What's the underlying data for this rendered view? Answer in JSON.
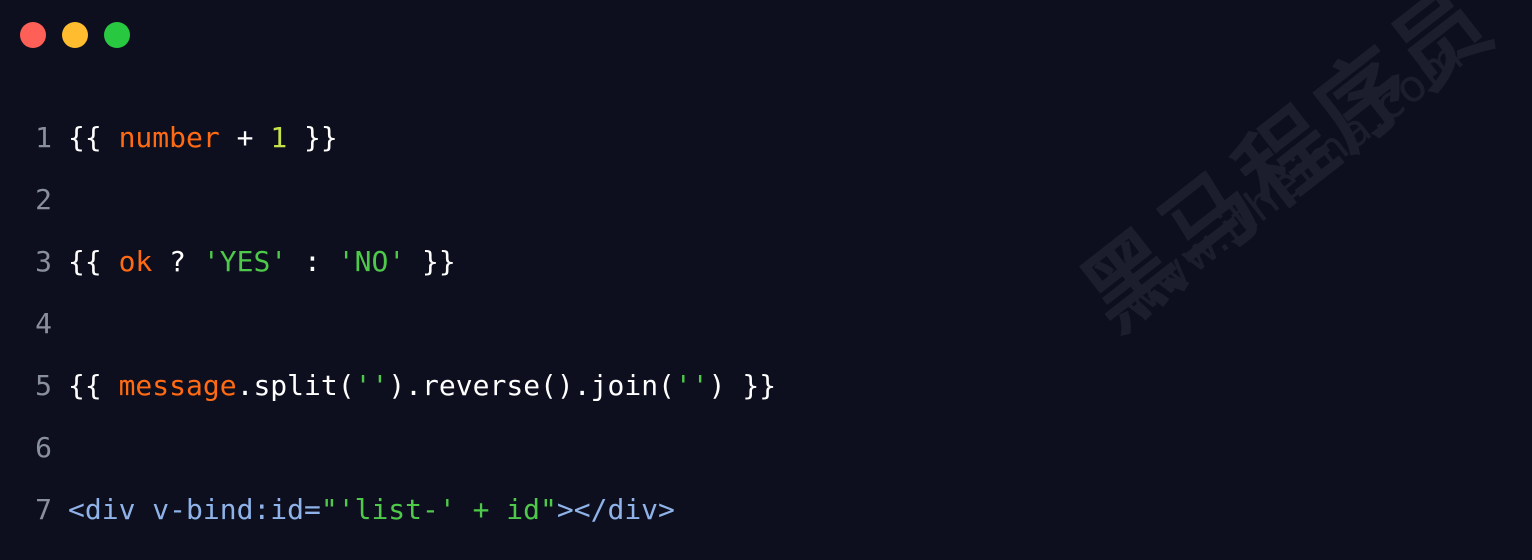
{
  "colors": {
    "background": "#0d0f1f",
    "line_number": "#8a8f9c",
    "white": "#ffffff",
    "variable": "#ff6a13",
    "number": "#c6e24a",
    "string": "#4ec94a",
    "tag": "#8fb3e8"
  },
  "window_controls": [
    "close-dot",
    "minimize-dot",
    "maximize-dot"
  ],
  "code": {
    "lines": [
      {
        "number": "1",
        "tokens": [
          {
            "text": "{{ ",
            "color": "white"
          },
          {
            "text": "number",
            "color": "variable"
          },
          {
            "text": " + ",
            "color": "white"
          },
          {
            "text": "1",
            "color": "number"
          },
          {
            "text": " }}",
            "color": "white"
          }
        ]
      },
      {
        "number": "2",
        "tokens": []
      },
      {
        "number": "3",
        "tokens": [
          {
            "text": "{{ ",
            "color": "white"
          },
          {
            "text": "ok",
            "color": "variable"
          },
          {
            "text": " ? ",
            "color": "white"
          },
          {
            "text": "'YES'",
            "color": "string"
          },
          {
            "text": " : ",
            "color": "white"
          },
          {
            "text": "'NO'",
            "color": "string"
          },
          {
            "text": " }}",
            "color": "white"
          }
        ]
      },
      {
        "number": "4",
        "tokens": []
      },
      {
        "number": "5",
        "tokens": [
          {
            "text": "{{ ",
            "color": "white"
          },
          {
            "text": "message",
            "color": "variable"
          },
          {
            "text": ".split(",
            "color": "white"
          },
          {
            "text": "''",
            "color": "string"
          },
          {
            "text": ").reverse().join(",
            "color": "white"
          },
          {
            "text": "''",
            "color": "string"
          },
          {
            "text": ") }}",
            "color": "white"
          }
        ]
      },
      {
        "number": "6",
        "tokens": []
      },
      {
        "number": "7",
        "tokens": [
          {
            "text": "<div v-bind:id=",
            "color": "tag"
          },
          {
            "text": "\"'list-' + id\"",
            "color": "string"
          },
          {
            "text": "></div>",
            "color": "tag"
          }
        ]
      }
    ]
  },
  "watermark": {
    "chinese": "黑马程序员",
    "url": "www.itheima.com"
  }
}
